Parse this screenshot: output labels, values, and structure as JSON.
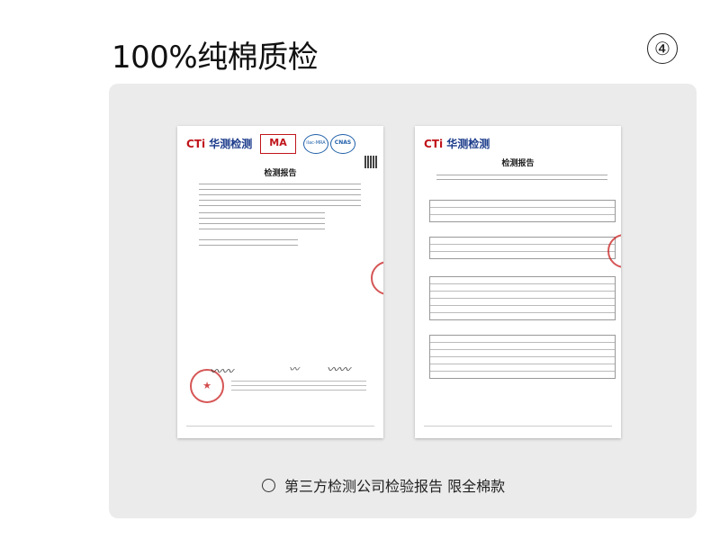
{
  "header": {
    "title": "100%纯棉质检",
    "step": "④"
  },
  "caption": "第三方检测公司检验报告 限全棉款",
  "report_left": {
    "logo_prefix": "CTi",
    "logo_text": "华测检测",
    "ma_label": "MA",
    "cnas_label": "CNAS",
    "ilac_label": "ilac-MRA",
    "title": "检测报告"
  },
  "report_right": {
    "logo_prefix": "CTi",
    "logo_text": "华测检测",
    "title": "检测报告"
  },
  "colors": {
    "panel_bg": "#ebebeb",
    "brand_blue": "#1a3a8a",
    "brand_red": "#c0151b"
  }
}
